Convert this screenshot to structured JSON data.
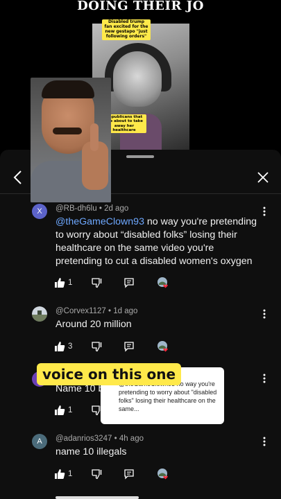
{
  "video": {
    "headline": "DOING THEIR JO",
    "caption_top": "Disabled trump fan excited for the new gestapo \"just following orders\"",
    "caption_bottom": "Republicans that are about to take away her healthcare"
  },
  "overlay": {
    "voice_caption": "voice on this one",
    "reply_card_text": "@theGameClown93 no way you're pretending to worry about \"disabled folks\" losing their healthcare on the same...",
    "reply_card_header": "6lu"
  },
  "comments": [
    {
      "avatar_letter": "X",
      "avatar_color": "#5c63c9",
      "author": "@RB-dh6lu",
      "time": "2d ago",
      "mention": "@theGameClown93",
      "text": " no way you're pretending to worry about “disabled folks” losing their healthcare on the same video you're pretending to cut a disabled women's oxygen",
      "likes": "1"
    },
    {
      "avatar_letter": "",
      "avatar_color": "#6d7a66",
      "author": "@Corvex1127",
      "time": "1d ago",
      "text": "Around 20 million",
      "likes": "3"
    },
    {
      "avatar_letter": "",
      "avatar_color": "#6a3fb5",
      "text": "Name 10 b",
      "likes": "1"
    },
    {
      "avatar_letter": "A",
      "avatar_color": "#4b6b7a",
      "author": "@adanrios3247",
      "time": "4h ago",
      "text": "name 10 illegals",
      "likes": "1"
    }
  ],
  "icons": {
    "back": "chevron-left-icon",
    "close": "close-icon",
    "like": "thumbs-up-icon",
    "dislike": "thumbs-down-icon",
    "reply": "reply-icon",
    "more": "more-vert-icon"
  }
}
